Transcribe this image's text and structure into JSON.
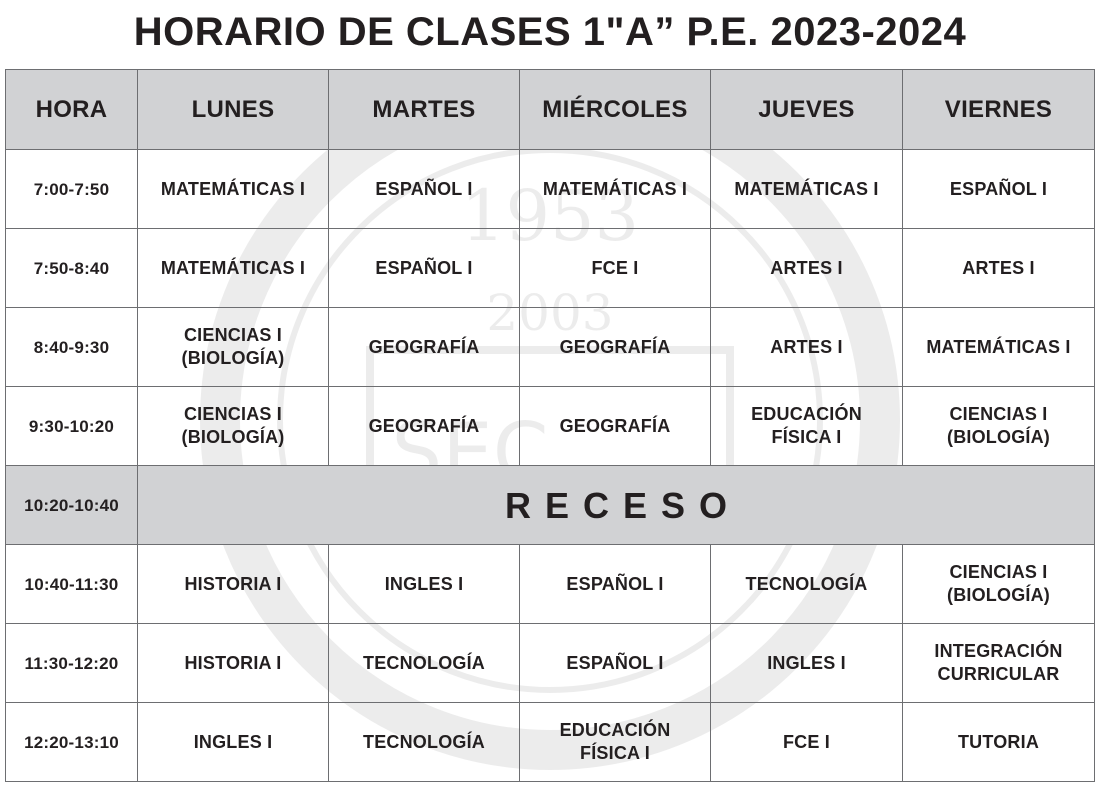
{
  "title": "HORARIO DE CLASES 1\"A” P.E. 2023-2024",
  "columns": [
    "HORA",
    "LUNES",
    "MARTES",
    "MIÉRCOLES",
    "JUEVES",
    "VIERNES"
  ],
  "rows": [
    {
      "time": "7:00-7:50",
      "cells": [
        "MATEMÁTICAS I",
        "ESPAÑOL I",
        "MATEMÁTICAS I",
        "MATEMÁTICAS I",
        "ESPAÑOL I"
      ]
    },
    {
      "time": "7:50-8:40",
      "cells": [
        "MATEMÁTICAS I",
        "ESPAÑOL I",
        "FCE I",
        "ARTES I",
        "ARTES I"
      ]
    },
    {
      "time": "8:40-9:30",
      "cells": [
        "CIENCIAS I\n(BIOLOGÍA)",
        "GEOGRAFÍA",
        "GEOGRAFÍA",
        "ARTES I",
        "MATEMÁTICAS I"
      ]
    },
    {
      "time": "9:30-10:20",
      "cells": [
        "CIENCIAS I\n(BIOLOGÍA)",
        "GEOGRAFÍA",
        "GEOGRAFÍA",
        "EDUCACIÓN\nFÍSICA I",
        "CIENCIAS I\n(BIOLOGÍA)"
      ]
    }
  ],
  "recess": {
    "time": "10:20-10:40",
    "label": "RECESO"
  },
  "rows_after": [
    {
      "time": "10:40-11:30",
      "cells": [
        "HISTORIA I",
        "INGLES I",
        "ESPAÑOL I",
        "TECNOLOGÍA",
        "CIENCIAS I\n(BIOLOGÍA)"
      ]
    },
    {
      "time": "11:30-12:20",
      "cells": [
        "HISTORIA I",
        "TECNOLOGÍA",
        "ESPAÑOL I",
        "INGLES I",
        "INTEGRACIÓN\nCURRICULAR"
      ]
    },
    {
      "time": "12:20-13:10",
      "cells": [
        "INGLES I",
        "TECNOLOGÍA",
        "EDUCACIÓN\nFÍSICA I",
        "FCE I",
        "TUTORIA"
      ]
    }
  ],
  "watermark": {
    "year_top": "1953",
    "year_mid": "2003",
    "text": "SEC"
  },
  "colors": {
    "header_bg": "#d1d2d4",
    "border": "#6d6e71",
    "text": "#231f20"
  }
}
